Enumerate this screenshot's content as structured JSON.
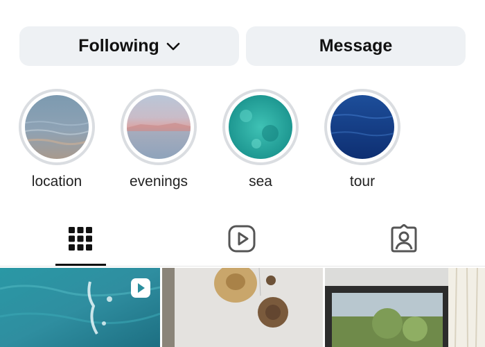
{
  "actions": {
    "following_label": "Following",
    "message_label": "Message"
  },
  "highlights": [
    {
      "label": "location"
    },
    {
      "label": "evenings"
    },
    {
      "label": "sea"
    },
    {
      "label": "tour"
    }
  ],
  "tabs": [
    {
      "icon": "grid-icon",
      "selected": true
    },
    {
      "icon": "reels-icon",
      "selected": false
    },
    {
      "icon": "tagged-icon",
      "selected": false
    }
  ],
  "posts": [
    {
      "type": "video",
      "icon": "reel-play-icon",
      "subject": "sea water"
    },
    {
      "type": "image",
      "subject": "hats on wall"
    },
    {
      "type": "image",
      "subject": "window view"
    }
  ],
  "colors": {
    "button_bg": "#eef1f4",
    "ring": "#dadde1",
    "text": "#111111"
  }
}
